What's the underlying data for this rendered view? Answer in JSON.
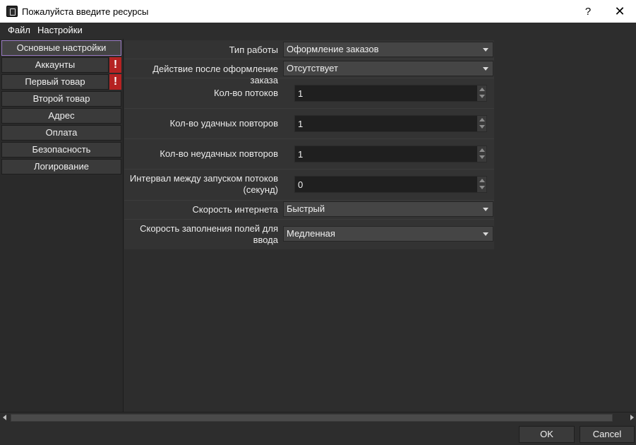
{
  "window": {
    "title": "Пожалуйста введите ресурсы",
    "help_label": "?",
    "close_label": "✕"
  },
  "menu": {
    "file": "Файл",
    "settings": "Настройки"
  },
  "nav": {
    "items": [
      {
        "label": "Основные настройки",
        "active": true,
        "warning": false
      },
      {
        "label": "Аккаунты",
        "active": false,
        "warning": true
      },
      {
        "label": "Первый товар",
        "active": false,
        "warning": true
      },
      {
        "label": "Второй товар",
        "active": false,
        "warning": false
      },
      {
        "label": "Адрес",
        "active": false,
        "warning": false
      },
      {
        "label": "Оплата",
        "active": false,
        "warning": false
      },
      {
        "label": "Безопасность",
        "active": false,
        "warning": false
      },
      {
        "label": "Логирование",
        "active": false,
        "warning": false
      }
    ],
    "warning_mark": "!"
  },
  "form": {
    "work_type": {
      "label": "Тип работы",
      "value": "Оформление заказов"
    },
    "after_order": {
      "label": "Действие после оформление заказа",
      "value": "Отсутствует"
    },
    "threads": {
      "label": "Кол-во потоков",
      "value": "1"
    },
    "success_retries": {
      "label": "Кол-во удачных повторов",
      "value": "1"
    },
    "fail_retries": {
      "label": "Кол-во неудачных повторов",
      "value": "1"
    },
    "thread_interval": {
      "label_line1": "Интервал между запуском потоков",
      "label_line2": "(секунд)",
      "value": "0"
    },
    "internet_speed": {
      "label": "Скорость интернета",
      "value": "Быстрый"
    },
    "fill_speed": {
      "label_line1": "Скорость заполнения полей для",
      "label_line2": "ввода",
      "value": "Медленная"
    }
  },
  "footer": {
    "ok_label": "OK",
    "cancel_label": "Cancel"
  }
}
